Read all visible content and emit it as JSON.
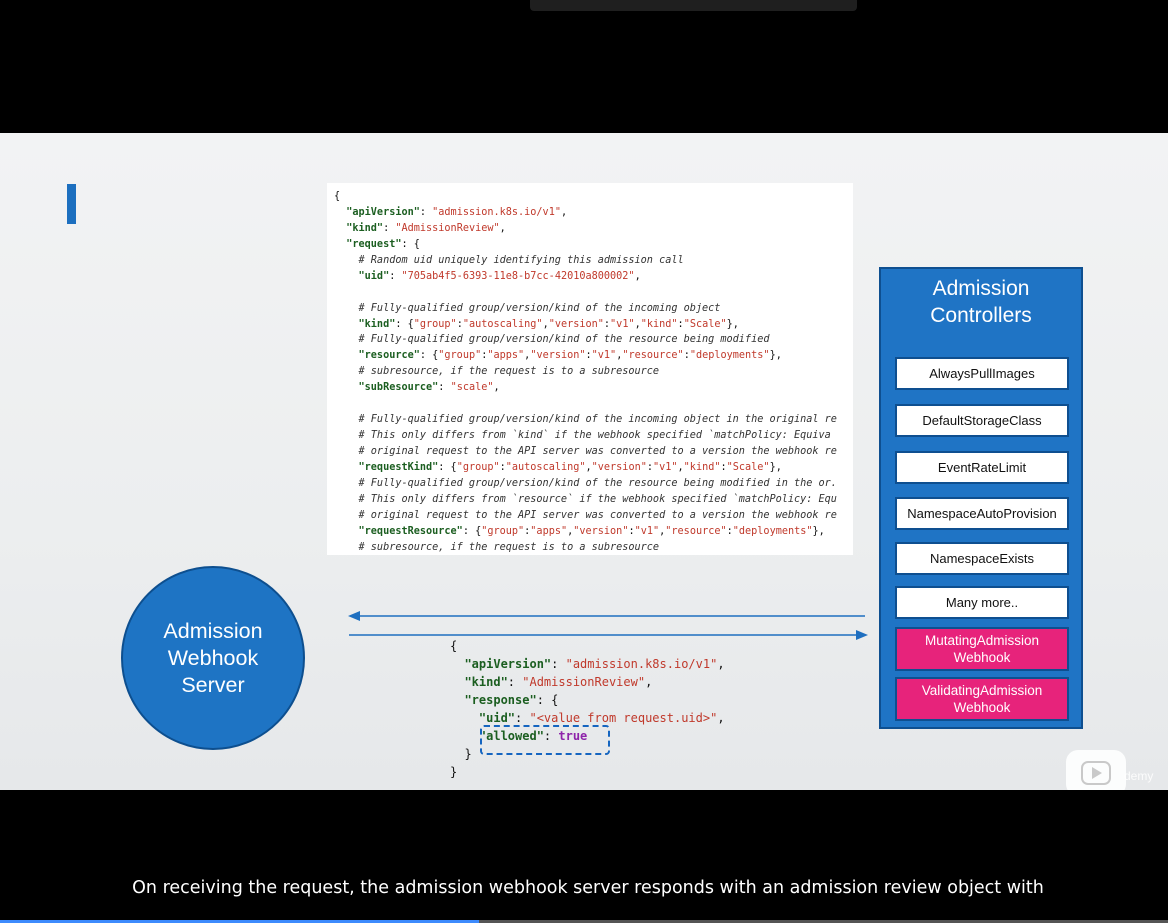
{
  "code_lines": [
    [
      {
        "t": "{",
        "c": "p"
      }
    ],
    [
      {
        "t": "  \"apiVersion\"",
        "c": "k"
      },
      {
        "t": ": ",
        "c": "p"
      },
      {
        "t": "\"admission.k8s.io/v1\"",
        "c": "s"
      },
      {
        "t": ",",
        "c": "p"
      }
    ],
    [
      {
        "t": "  \"kind\"",
        "c": "k"
      },
      {
        "t": ": ",
        "c": "p"
      },
      {
        "t": "\"AdmissionReview\"",
        "c": "s"
      },
      {
        "t": ",",
        "c": "p"
      }
    ],
    [
      {
        "t": "  \"request\"",
        "c": "k"
      },
      {
        "t": ": {",
        "c": "p"
      }
    ],
    [
      {
        "t": "    # Random uid uniquely identifying this admission call",
        "c": "c"
      }
    ],
    [
      {
        "t": "    \"uid\"",
        "c": "k"
      },
      {
        "t": ": ",
        "c": "p"
      },
      {
        "t": "\"705ab4f5-6393-11e8-b7cc-42010a800002\"",
        "c": "s"
      },
      {
        "t": ",",
        "c": "p"
      }
    ],
    [
      {
        "t": "",
        "c": "p"
      }
    ],
    [
      {
        "t": "    # Fully-qualified group/version/kind of the incoming object",
        "c": "c"
      }
    ],
    [
      {
        "t": "    \"kind\"",
        "c": "k"
      },
      {
        "t": ": {",
        "c": "p"
      },
      {
        "t": "\"group\"",
        "c": "s"
      },
      {
        "t": ":",
        "c": "p"
      },
      {
        "t": "\"autoscaling\"",
        "c": "s"
      },
      {
        "t": ",",
        "c": "p"
      },
      {
        "t": "\"version\"",
        "c": "s"
      },
      {
        "t": ":",
        "c": "p"
      },
      {
        "t": "\"v1\"",
        "c": "s"
      },
      {
        "t": ",",
        "c": "p"
      },
      {
        "t": "\"kind\"",
        "c": "s"
      },
      {
        "t": ":",
        "c": "p"
      },
      {
        "t": "\"Scale\"",
        "c": "s"
      },
      {
        "t": "},",
        "c": "p"
      }
    ],
    [
      {
        "t": "    # Fully-qualified group/version/kind of the resource being modified",
        "c": "c"
      }
    ],
    [
      {
        "t": "    \"resource\"",
        "c": "k"
      },
      {
        "t": ": {",
        "c": "p"
      },
      {
        "t": "\"group\"",
        "c": "s"
      },
      {
        "t": ":",
        "c": "p"
      },
      {
        "t": "\"apps\"",
        "c": "s"
      },
      {
        "t": ",",
        "c": "p"
      },
      {
        "t": "\"version\"",
        "c": "s"
      },
      {
        "t": ":",
        "c": "p"
      },
      {
        "t": "\"v1\"",
        "c": "s"
      },
      {
        "t": ",",
        "c": "p"
      },
      {
        "t": "\"resource\"",
        "c": "s"
      },
      {
        "t": ":",
        "c": "p"
      },
      {
        "t": "\"deployments\"",
        "c": "s"
      },
      {
        "t": "},",
        "c": "p"
      }
    ],
    [
      {
        "t": "    # subresource, if the request is to a subresource",
        "c": "c"
      }
    ],
    [
      {
        "t": "    \"subResource\"",
        "c": "k"
      },
      {
        "t": ": ",
        "c": "p"
      },
      {
        "t": "\"scale\"",
        "c": "s"
      },
      {
        "t": ",",
        "c": "p"
      }
    ],
    [
      {
        "t": "",
        "c": "p"
      }
    ],
    [
      {
        "t": "    # Fully-qualified group/version/kind of the incoming object in the original re",
        "c": "c"
      }
    ],
    [
      {
        "t": "    # This only differs from `kind` if the webhook specified `matchPolicy: Equiva",
        "c": "c"
      }
    ],
    [
      {
        "t": "    # original request to the API server was converted to a version the webhook re",
        "c": "c"
      }
    ],
    [
      {
        "t": "    \"requestKind\"",
        "c": "k"
      },
      {
        "t": ": {",
        "c": "p"
      },
      {
        "t": "\"group\"",
        "c": "s"
      },
      {
        "t": ":",
        "c": "p"
      },
      {
        "t": "\"autoscaling\"",
        "c": "s"
      },
      {
        "t": ",",
        "c": "p"
      },
      {
        "t": "\"version\"",
        "c": "s"
      },
      {
        "t": ":",
        "c": "p"
      },
      {
        "t": "\"v1\"",
        "c": "s"
      },
      {
        "t": ",",
        "c": "p"
      },
      {
        "t": "\"kind\"",
        "c": "s"
      },
      {
        "t": ":",
        "c": "p"
      },
      {
        "t": "\"Scale\"",
        "c": "s"
      },
      {
        "t": "},",
        "c": "p"
      }
    ],
    [
      {
        "t": "    # Fully-qualified group/version/kind of the resource being modified in the or.",
        "c": "c"
      }
    ],
    [
      {
        "t": "    # This only differs from `resource` if the webhook specified `matchPolicy: Equ",
        "c": "c"
      }
    ],
    [
      {
        "t": "    # original request to the API server was converted to a version the webhook re",
        "c": "c"
      }
    ],
    [
      {
        "t": "    \"requestResource\"",
        "c": "k"
      },
      {
        "t": ": {",
        "c": "p"
      },
      {
        "t": "\"group\"",
        "c": "s"
      },
      {
        "t": ":",
        "c": "p"
      },
      {
        "t": "\"apps\"",
        "c": "s"
      },
      {
        "t": ",",
        "c": "p"
      },
      {
        "t": "\"version\"",
        "c": "s"
      },
      {
        "t": ":",
        "c": "p"
      },
      {
        "t": "\"v1\"",
        "c": "s"
      },
      {
        "t": ",",
        "c": "p"
      },
      {
        "t": "\"resource\"",
        "c": "s"
      },
      {
        "t": ":",
        "c": "p"
      },
      {
        "t": "\"deployments\"",
        "c": "s"
      },
      {
        "t": "},",
        "c": "p"
      }
    ],
    [
      {
        "t": "    # subresource, if the request is to a subresource",
        "c": "c"
      }
    ]
  ],
  "response_lines": [
    [
      {
        "t": "{",
        "c": "p"
      }
    ],
    [
      {
        "t": "  \"apiVersion\"",
        "c": "k"
      },
      {
        "t": ": ",
        "c": "p"
      },
      {
        "t": "\"admission.k8s.io/v1\"",
        "c": "s"
      },
      {
        "t": ",",
        "c": "p"
      }
    ],
    [
      {
        "t": "  \"kind\"",
        "c": "k"
      },
      {
        "t": ": ",
        "c": "p"
      },
      {
        "t": "\"AdmissionReview\"",
        "c": "s"
      },
      {
        "t": ",",
        "c": "p"
      }
    ],
    [
      {
        "t": "  \"response\"",
        "c": "k"
      },
      {
        "t": ": {",
        "c": "p"
      }
    ],
    [
      {
        "t": "    \"uid\"",
        "c": "k"
      },
      {
        "t": ": ",
        "c": "p"
      },
      {
        "t": "\"<value from request.uid>\"",
        "c": "s"
      },
      {
        "t": ",",
        "c": "p"
      }
    ],
    [
      {
        "t": "    \"allowed\"",
        "c": "k"
      },
      {
        "t": ": ",
        "c": "p"
      },
      {
        "t": "true",
        "c": "bool"
      }
    ],
    [
      {
        "t": "  }",
        "c": "p"
      }
    ],
    [
      {
        "t": "}",
        "c": "p"
      }
    ]
  ],
  "webhook_server": {
    "label_line1": "Admission",
    "label_line2": "Webhook",
    "label_line3": "Server"
  },
  "admission_controllers": {
    "title_line1": "Admission",
    "title_line2": "Controllers",
    "items": [
      {
        "line1": "AlwaysPullImages",
        "line2": "",
        "highlight": false
      },
      {
        "line1": "DefaultStorageClass",
        "line2": "",
        "highlight": false
      },
      {
        "line1": "EventRateLimit",
        "line2": "",
        "highlight": false
      },
      {
        "line1": "NamespaceAutoProvision",
        "line2": "",
        "highlight": false
      },
      {
        "line1": "NamespaceExists",
        "line2": "",
        "highlight": false
      },
      {
        "line1": "Many more..",
        "line2": "",
        "highlight": false
      },
      {
        "line1": "MutatingAdmission",
        "line2": "Webhook",
        "highlight": true
      },
      {
        "line1": "ValidatingAdmission",
        "line2": "Webhook",
        "highlight": true
      }
    ]
  },
  "player": {
    "watermark": "demy",
    "progress_fraction": 0.41
  },
  "caption": "On receiving the request, the admission webhook server responds with an admission review object with",
  "colors": {
    "accent_blue": "#1f74c5",
    "highlight_pink": "#e7237b",
    "json_key": "#1b5e20",
    "json_string": "#c0392b"
  }
}
